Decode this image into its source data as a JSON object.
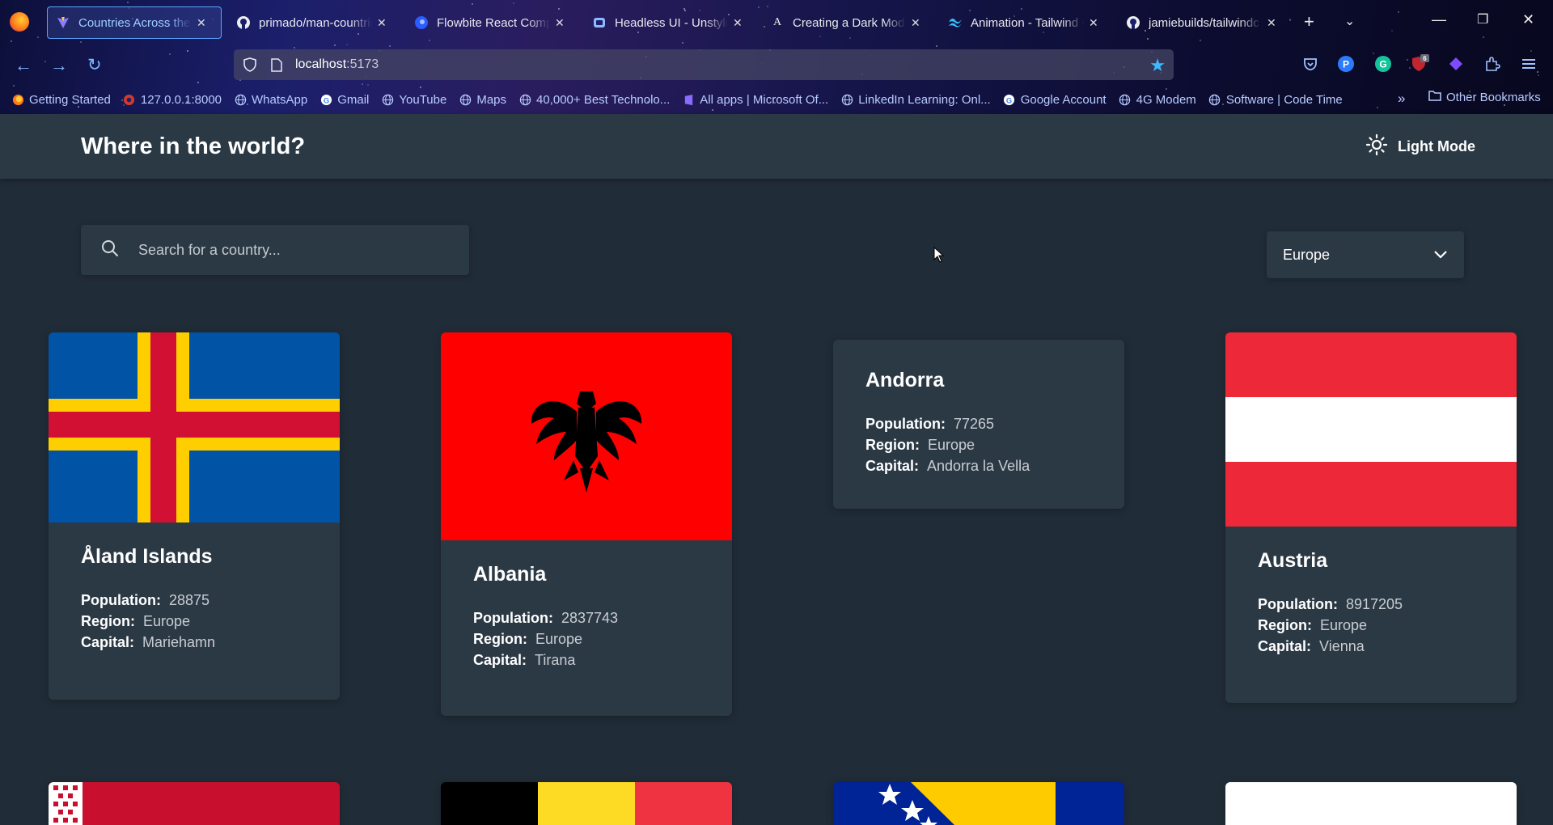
{
  "browser": {
    "tabs": [
      {
        "label": "Countries Across the G",
        "icon": "vite-icon",
        "active": true
      },
      {
        "label": "primado/man-countrie",
        "icon": "github-icon",
        "active": false
      },
      {
        "label": "Flowbite React Compo",
        "icon": "flowbite-icon",
        "active": false
      },
      {
        "label": "Headless UI - Unstyled",
        "icon": "headlessui-icon",
        "active": false
      },
      {
        "label": "Creating a Dark Mode",
        "icon": "a-letter-icon",
        "active": false
      },
      {
        "label": "Animation - Tailwind C",
        "icon": "tailwind-icon",
        "active": false
      },
      {
        "label": "jamiebuilds/tailwindc",
        "icon": "github-icon",
        "active": false
      }
    ],
    "url_host": "localhost",
    "url_port": ":5173",
    "extension_badge": "6",
    "bookmarks": [
      {
        "label": "Getting Started",
        "icon": "firefox-icon"
      },
      {
        "label": "127.0.0.1:8000",
        "icon": "django-icon"
      },
      {
        "label": "WhatsApp",
        "icon": "globe-icon"
      },
      {
        "label": "Gmail",
        "icon": "google-icon"
      },
      {
        "label": "YouTube",
        "icon": "globe-icon"
      },
      {
        "label": "Maps",
        "icon": "globe-icon"
      },
      {
        "label": "40,000+ Best Technolo...",
        "icon": "globe-icon"
      },
      {
        "label": "All apps | Microsoft Of...",
        "icon": "office-icon"
      },
      {
        "label": "LinkedIn Learning: Onl...",
        "icon": "globe-icon"
      },
      {
        "label": "Google Account",
        "icon": "google-icon"
      },
      {
        "label": "4G Modem",
        "icon": "globe-icon"
      },
      {
        "label": "Software | Code Time",
        "icon": "globe-icon"
      }
    ],
    "other_bookmarks": "Other Bookmarks"
  },
  "header": {
    "title": "Where in the world?",
    "mode_label": "Light Mode"
  },
  "search": {
    "placeholder": "Search for a country...",
    "value": ""
  },
  "region_filter": {
    "selected": "Europe"
  },
  "labels": {
    "population": "Population:",
    "region": "Region:",
    "capital": "Capital:"
  },
  "countries": [
    {
      "name": "Åland Islands",
      "population": "28875",
      "region": "Europe",
      "capital": "Mariehamn",
      "flag": "aland-flag"
    },
    {
      "name": "Albania",
      "population": "2837743",
      "region": "Europe",
      "capital": "Tirana",
      "flag": "albania-flag"
    },
    {
      "name": "Andorra",
      "population": "77265",
      "region": "Europe",
      "capital": "Andorra la Vella",
      "flag": "andorra-flag-missing"
    },
    {
      "name": "Austria",
      "population": "8917205",
      "region": "Europe",
      "capital": "Vienna",
      "flag": "austria-flag"
    }
  ],
  "next_row_flags": [
    "belarus-flag",
    "belgium-flag",
    "bosnia-flag",
    "white-flag"
  ],
  "colors": {
    "page_bg": "#202c37",
    "element_bg": "#2b3945",
    "text": "#ffffff",
    "muted_text": "#c9cdd2"
  }
}
